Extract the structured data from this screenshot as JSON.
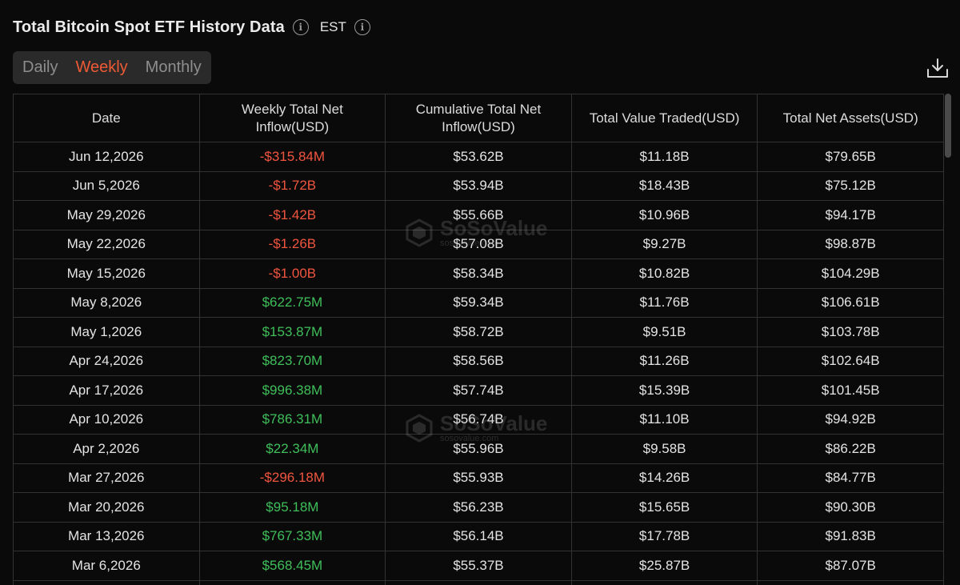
{
  "header": {
    "title": "Total Bitcoin Spot ETF History Data",
    "timezone": "EST"
  },
  "tabs": [
    {
      "label": "Daily",
      "active": false
    },
    {
      "label": "Weekly",
      "active": true
    },
    {
      "label": "Monthly",
      "active": false
    }
  ],
  "table": {
    "columns": [
      "Date",
      "Weekly Total Net Inflow(USD)",
      "Cumulative Total Net Inflow(USD)",
      "Total Value Traded(USD)",
      "Total Net Assets(USD)"
    ],
    "rows": [
      {
        "date": "Jun 12,2026",
        "inflow": "-$315.84M",
        "cumulative": "$53.62B",
        "traded": "$11.18B",
        "assets": "$79.65B"
      },
      {
        "date": "Jun 5,2026",
        "inflow": "-$1.72B",
        "cumulative": "$53.94B",
        "traded": "$18.43B",
        "assets": "$75.12B"
      },
      {
        "date": "May 29,2026",
        "inflow": "-$1.42B",
        "cumulative": "$55.66B",
        "traded": "$10.96B",
        "assets": "$94.17B"
      },
      {
        "date": "May 22,2026",
        "inflow": "-$1.26B",
        "cumulative": "$57.08B",
        "traded": "$9.27B",
        "assets": "$98.87B"
      },
      {
        "date": "May 15,2026",
        "inflow": "-$1.00B",
        "cumulative": "$58.34B",
        "traded": "$10.82B",
        "assets": "$104.29B"
      },
      {
        "date": "May 8,2026",
        "inflow": "$622.75M",
        "cumulative": "$59.34B",
        "traded": "$11.76B",
        "assets": "$106.61B"
      },
      {
        "date": "May 1,2026",
        "inflow": "$153.87M",
        "cumulative": "$58.72B",
        "traded": "$9.51B",
        "assets": "$103.78B"
      },
      {
        "date": "Apr 24,2026",
        "inflow": "$823.70M",
        "cumulative": "$58.56B",
        "traded": "$11.26B",
        "assets": "$102.64B"
      },
      {
        "date": "Apr 17,2026",
        "inflow": "$996.38M",
        "cumulative": "$57.74B",
        "traded": "$15.39B",
        "assets": "$101.45B"
      },
      {
        "date": "Apr 10,2026",
        "inflow": "$786.31M",
        "cumulative": "$56.74B",
        "traded": "$11.10B",
        "assets": "$94.92B"
      },
      {
        "date": "Apr 2,2026",
        "inflow": "$22.34M",
        "cumulative": "$55.96B",
        "traded": "$9.58B",
        "assets": "$86.22B"
      },
      {
        "date": "Mar 27,2026",
        "inflow": "-$296.18M",
        "cumulative": "$55.93B",
        "traded": "$14.26B",
        "assets": "$84.77B"
      },
      {
        "date": "Mar 20,2026",
        "inflow": "$95.18M",
        "cumulative": "$56.23B",
        "traded": "$15.65B",
        "assets": "$90.30B"
      },
      {
        "date": "Mar 13,2026",
        "inflow": "$767.33M",
        "cumulative": "$56.14B",
        "traded": "$17.78B",
        "assets": "$91.83B"
      },
      {
        "date": "Mar 6,2026",
        "inflow": "$568.45M",
        "cumulative": "$55.37B",
        "traded": "$25.87B",
        "assets": "$87.07B"
      },
      {
        "date": "",
        "inflow": "",
        "cumulative": "",
        "traded": "",
        "assets": ""
      }
    ]
  },
  "watermark": {
    "name": "SoSoValue",
    "url": "sosovalue.com"
  },
  "icons": {
    "info": "info-circle-icon",
    "download": "download-icon"
  },
  "colors": {
    "negative": "#f0553f",
    "positive": "#3fbf5a",
    "accent": "#ee5a35"
  }
}
